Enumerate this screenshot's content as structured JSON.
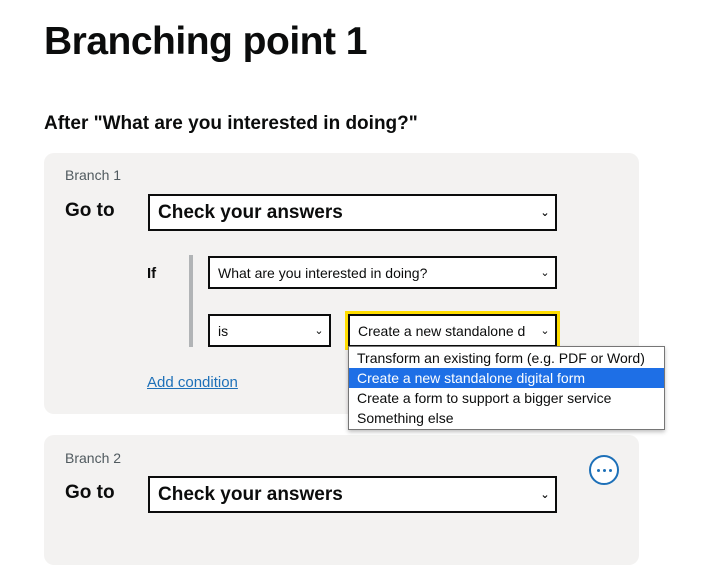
{
  "page": {
    "title": "Branching point 1",
    "section_heading": "After \"What are you interested in doing?\""
  },
  "branches": [
    {
      "label": "Branch 1",
      "goto_label": "Go to",
      "goto_value": "Check your answers",
      "condition": {
        "if_label": "If",
        "question_value": "What are you interested in doing?",
        "operator_value": "is",
        "answer_value": "Create a new standalone d"
      },
      "add_condition_label": "Add condition"
    },
    {
      "label": "Branch 2",
      "goto_label": "Go to",
      "goto_value": "Check your answers",
      "more_icon": "ellipsis-icon"
    }
  ],
  "answer_dropdown": {
    "options": [
      "Transform an existing form (e.g. PDF or Word)",
      "Create a new standalone digital form",
      "Create a form to support a bigger service",
      "Something else"
    ],
    "selected_index": 1
  },
  "colors": {
    "card_background": "#f3f2f1",
    "link": "#1d70b8",
    "focus": "#ffdd00",
    "option_highlight": "#1e6fe6"
  }
}
